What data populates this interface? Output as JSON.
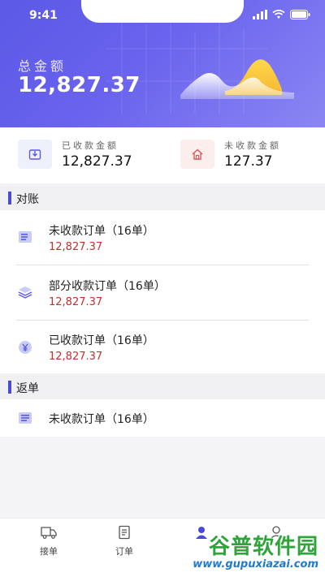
{
  "status": {
    "time": "9:41"
  },
  "header": {
    "total_label": "总金额",
    "total_value": "12,827.37"
  },
  "summary": {
    "received": {
      "label": "已收款金额",
      "value": "12,827.37",
      "icon": "inbox-download-icon"
    },
    "unreceived": {
      "label": "未收款金额",
      "value": "127.37",
      "icon": "house-icon"
    }
  },
  "reconcile": {
    "title": "对账",
    "items": [
      {
        "title": "未收款订单（16单）",
        "amount": "12,827.37",
        "icon": "list-icon"
      },
      {
        "title": "部分收款订单（16单）",
        "amount": "12,827.37",
        "icon": "layers-icon"
      },
      {
        "title": "已收款订单（16单）",
        "amount": "12,827.37",
        "icon": "yen-coin-icon"
      }
    ]
  },
  "rebate": {
    "title": "返单",
    "items": [
      {
        "title": "未收款订单（16单）",
        "icon": "list-icon"
      }
    ]
  },
  "tabbar": {
    "tabs": [
      {
        "label": "接单",
        "icon": "truck-icon"
      },
      {
        "label": "订单",
        "icon": "document-icon"
      },
      {
        "label": "",
        "icon": "user-icon"
      },
      {
        "label": "",
        "icon": "profile-icon"
      }
    ]
  },
  "watermark": {
    "text": "谷普软件园",
    "url": "www.gupuxiazai.com"
  },
  "colors": {
    "accent": "#5b59e6",
    "amount": "#c42f2f",
    "watermark_green": "#2ea43a",
    "watermark_blue": "#1f7ac9"
  }
}
